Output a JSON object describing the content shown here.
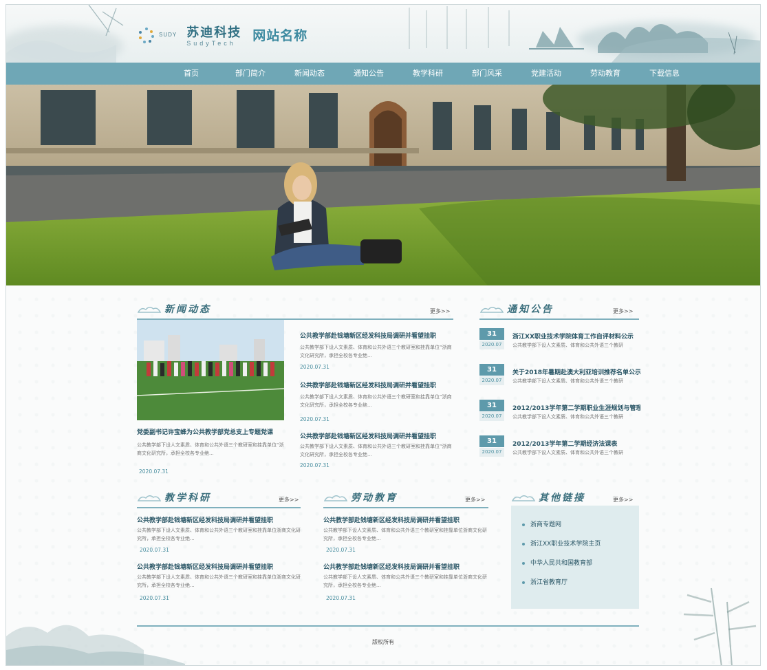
{
  "header": {
    "logo_mark": "SUDY",
    "logo_cn": "苏迪科技",
    "logo_en": "SudyTech",
    "site_name": "网站名称"
  },
  "nav": {
    "items": [
      "首页",
      "部门简介",
      "新闻动态",
      "通知公告",
      "教学科研",
      "部门风采",
      "党建活动",
      "劳动教育",
      "下载信息"
    ]
  },
  "news": {
    "title": "新闻动态",
    "more": "更多>>",
    "lead": {
      "title": "党委副书记许宝蜂为公共教学部党总支上专题党课",
      "desc": "公共教学部下设人文素质、体育和公共外语三个教研室和挂靠单位“浙商文化研究所，承担全校各专业绝...",
      "date": "2020.07.31"
    },
    "items": [
      {
        "title": "公共教学部赴钱塘新区经发科技局调研并看望挂职",
        "desc": "公共教学部下设人文素质、体育和公共外语三个教研室和挂靠单位“浙商文化研究所，承担全校各专业绝...",
        "date": "2020.07.31"
      },
      {
        "title": "公共教学部赴钱塘新区经发科技局调研并看望挂职",
        "desc": "公共教学部下设人文素质、体育和公共外语三个教研室和挂靠单位“浙商文化研究所，承担全校各专业绝...",
        "date": "2020.07.31"
      },
      {
        "title": "公共教学部赴钱塘新区经发科技局调研并看望挂职",
        "desc": "公共教学部下设人文素质、体育和公共外语三个教研室和挂靠单位“浙商文化研究所，承担全校各专业绝...",
        "date": "2020.07.31"
      }
    ]
  },
  "notice": {
    "title": "通知公告",
    "more": "更多>>",
    "items": [
      {
        "day": "31",
        "ym": "2020.07",
        "title": "浙江XX职业技术学院体育工作自评材料公示",
        "desc": "公共教学部下设人文素质、体育和公共外语三个教研"
      },
      {
        "day": "31",
        "ym": "2020.07",
        "title": "关于2018年暑期赴澳大利亚培训推荐名单公示",
        "desc": "公共教学部下设人文素质、体育和公共外语三个教研"
      },
      {
        "day": "31",
        "ym": "2020.07",
        "title": "2012/2013学年第二学期职业生涯规划与管理",
        "desc": "公共教学部下设人文素质、体育和公共外语三个教研"
      },
      {
        "day": "31",
        "ym": "2020.07",
        "title": "2012/2013学年第二学期经济法课表",
        "desc": "公共教学部下设人文素质、体育和公共外语三个教研"
      }
    ]
  },
  "teaching": {
    "title": "教学科研",
    "more": "更多>>",
    "items": [
      {
        "title": "公共教学部赴钱塘新区经发科技局调研并看望挂职",
        "desc": "公共教学部下设人文素质、体育和公共外语三个教研室和挂靠单位浙商文化研究所，承担全校各专业绝...",
        "date": "2020.07.31"
      },
      {
        "title": "公共教学部赴钱塘新区经发科技局调研并看望挂职",
        "desc": "公共教学部下设人文素质、体育和公共外语三个教研室和挂靠单位浙商文化研究所，承担全校各专业绝...",
        "date": "2020.07.31"
      }
    ]
  },
  "labor": {
    "title": "劳动教育",
    "more": "更多>>",
    "items": [
      {
        "title": "公共教学部赴钱塘新区经发科技局调研并看望挂职",
        "desc": "公共教学部下设人文素质、体育和公共外语三个教研室和挂靠单位浙商文化研究所，承担全校各专业绝...",
        "date": "2020.07.31"
      },
      {
        "title": "公共教学部赴钱塘新区经发科技局调研并看望挂职",
        "desc": "公共教学部下设人文素质、体育和公共外语三个教研室和挂靠单位浙商文化研究所，承担全校各专业绝...",
        "date": "2020.07.31"
      }
    ]
  },
  "links": {
    "title": "其他链接",
    "more": "更多>>",
    "items": [
      "浙商专题网",
      "浙江XX职业技术学院主页",
      "中华人民共和国教育部",
      "浙江省教育厅"
    ]
  },
  "footer": {
    "copyright": "版权所有"
  },
  "colors": {
    "nav_bg": "#6fa7b6",
    "accent": "#5e9aab",
    "title_text": "#2a5666"
  }
}
